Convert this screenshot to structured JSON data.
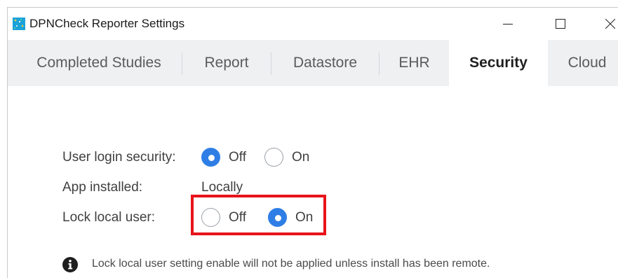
{
  "window": {
    "title": "DPNCheck Reporter Settings",
    "controls": {
      "minimize": "minimize-icon",
      "maximize": "maximize-icon",
      "close": "close-icon"
    }
  },
  "tabs": [
    {
      "label": "Completed Studies",
      "active": false
    },
    {
      "label": "Report",
      "active": false
    },
    {
      "label": "Datastore",
      "active": false
    },
    {
      "label": "EHR",
      "active": false
    },
    {
      "label": "Security",
      "active": true
    },
    {
      "label": "Cloud",
      "active": false
    }
  ],
  "security": {
    "user_login": {
      "label": "User login security:",
      "options": [
        {
          "label": "Off",
          "selected": true
        },
        {
          "label": "On",
          "selected": false
        }
      ]
    },
    "app_installed": {
      "label": "App installed:",
      "value": "Locally"
    },
    "lock_local_user": {
      "label": "Lock local user:",
      "options": [
        {
          "label": "Off",
          "selected": false
        },
        {
          "label": "On",
          "selected": true
        }
      ]
    },
    "info_note": "Lock local user setting enable will not be applied unless install has been remote."
  },
  "colors": {
    "accent": "#2f7ee6",
    "highlight": "#e8141b",
    "tabbar_bg": "#eef0f2"
  }
}
